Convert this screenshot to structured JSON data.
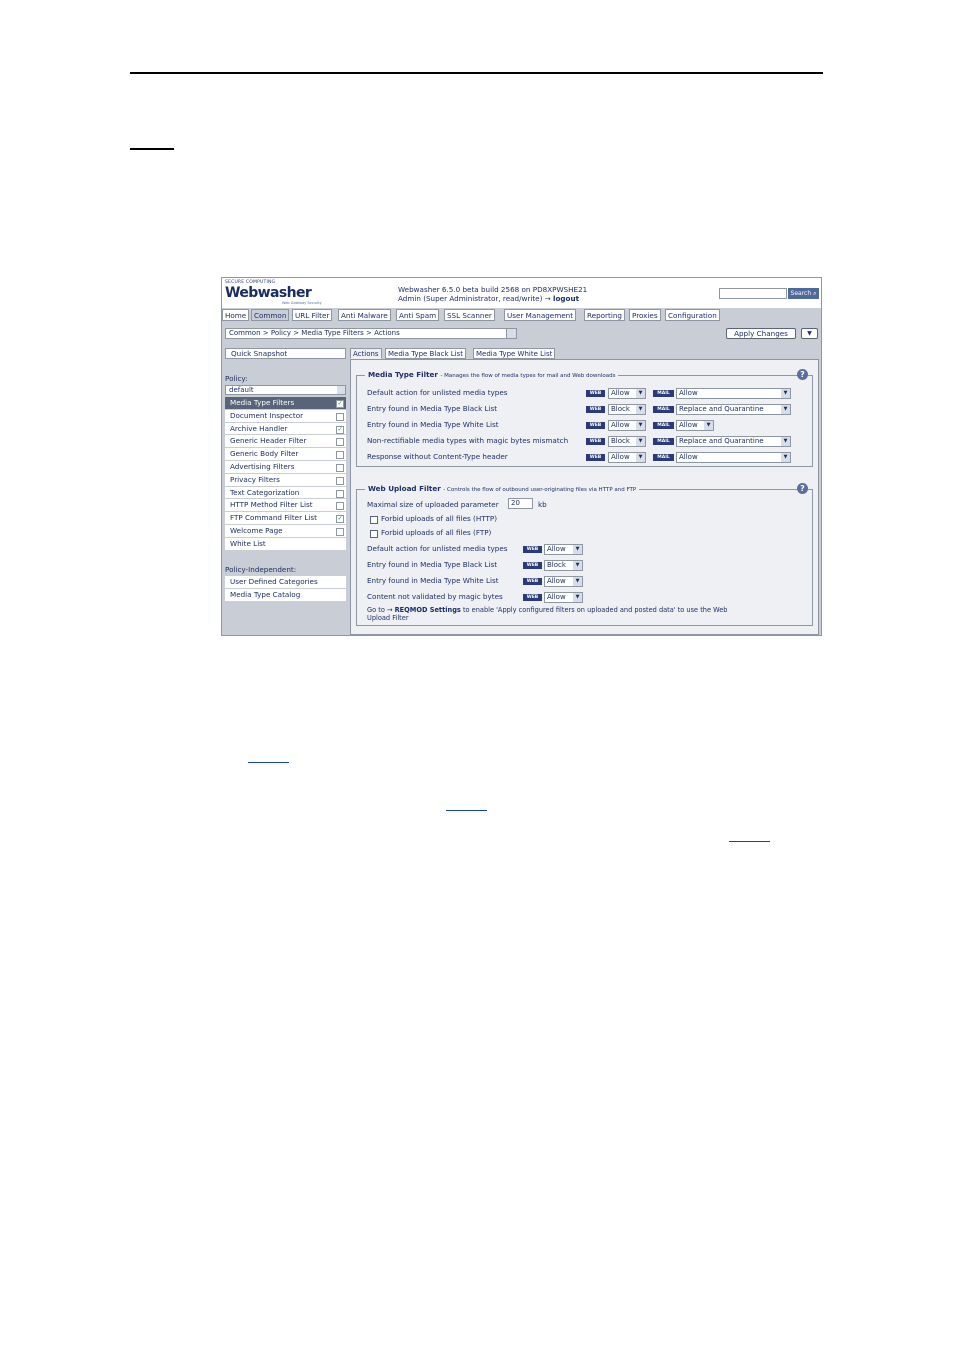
{
  "header": {
    "vendor_small": "SECURE COMPUTING",
    "brand": "Webwasher",
    "brand_tagline": "Web Gateway Security",
    "build": "Webwasher 6.5.0 beta build 2568 on PD8XPWSHE21",
    "user": "Admin (Super Administrator, read/write) →",
    "logout": "logout",
    "search_label": "Search"
  },
  "nav_tabs": [
    "Home",
    "Common",
    "URL Filter",
    "Anti Malware",
    "Anti Spam",
    "SSL Scanner",
    "User Management",
    "Reporting",
    "Proxies",
    "Configuration"
  ],
  "active_tab": "Common",
  "breadcrumb": "Common > Policy > Media Type Filters > Actions",
  "apply_label": "Apply Changes",
  "sidebar": {
    "quick_snapshot": "Quick Snapshot",
    "policy_label": "Policy:",
    "policy_value": "default",
    "items": [
      {
        "label": "Media Type Filters",
        "checked": "✓"
      },
      {
        "label": "Document Inspector",
        "checked": ""
      },
      {
        "label": "Archive Handler",
        "checked": "✓"
      },
      {
        "label": "Generic Header Filter",
        "checked": ""
      },
      {
        "label": "Generic Body Filter",
        "checked": ""
      },
      {
        "label": "Advertising Filters",
        "checked": ""
      },
      {
        "label": "Privacy Filters",
        "checked": ""
      },
      {
        "label": "Text Categorization",
        "checked": ""
      },
      {
        "label": "HTTP Method Filter List",
        "checked": ""
      },
      {
        "label": "FTP Command Filter List",
        "checked": "✓"
      },
      {
        "label": "Welcome Page",
        "checked": ""
      },
      {
        "label": "White List",
        "checked": ""
      }
    ],
    "independent_label": "Policy-Independent:",
    "independent_items": [
      "User Defined Categories",
      "Media Type Catalog"
    ]
  },
  "content_tabs": [
    "Actions",
    "Media Type Black List",
    "Media Type White List"
  ],
  "media_filter": {
    "title": "Media Type Filter",
    "subtitle": "- Manages the flow of media types for mail and Web downloads",
    "web_badge": "WEB",
    "mail_badge": "MAIL",
    "rows": [
      {
        "label": "Default action for unlisted media types",
        "web": "Allow",
        "mail": "Allow"
      },
      {
        "label": "Entry found in Media Type Black List",
        "web": "Block",
        "mail": "Replace and Quarantine"
      },
      {
        "label": "Entry found in Media Type White List",
        "web": "Allow",
        "mail": "Allow"
      },
      {
        "label": "Non-rectifiable media types with magic bytes mismatch",
        "web": "Block",
        "mail": "Replace and Quarantine"
      },
      {
        "label": "Response without Content-Type header",
        "web": "Allow",
        "mail": "Allow"
      }
    ]
  },
  "upload_filter": {
    "title": "Web Upload Filter",
    "subtitle": "- Controls the flow of outbound user-originating files via HTTP and FTP",
    "max_size_label": "Maximal size of uploaded parameter",
    "max_size_value": "20",
    "max_size_unit": "kb",
    "forbid_http": "Forbid uploads of all files (HTTP)",
    "forbid_ftp": "Forbid uploads of all files (FTP)",
    "rows": [
      {
        "label": "Default action for unlisted media types",
        "web": "Allow"
      },
      {
        "label": "Entry found in Media Type Black List",
        "web": "Block"
      },
      {
        "label": "Entry found in Media Type White List",
        "web": "Allow"
      },
      {
        "label": "Content not validated by magic bytes",
        "web": "Allow"
      }
    ],
    "note_pre": "Go to →",
    "note_link": "REQMOD Settings",
    "note_post": "to enable 'Apply configured filters on uploaded and posted data' to use the Web",
    "note_line2": "Upload Filter"
  },
  "colors": {
    "panel": "#c9cdd6",
    "content": "#eef0f4",
    "text": "#1f2e63",
    "badge": "#2a3a7a"
  }
}
